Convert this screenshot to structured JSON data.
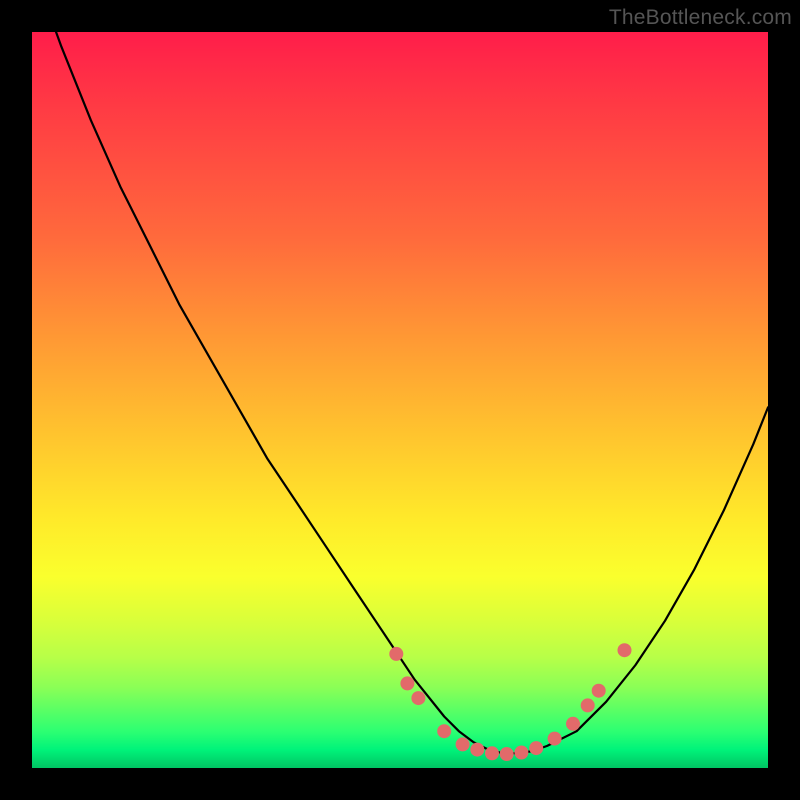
{
  "watermark": "TheBottleneck.com",
  "colors": {
    "frame_background": "#000000",
    "gradient_top": "#ff1d4a",
    "gradient_mid": "#ffe92a",
    "gradient_bottom": "#00c463",
    "curve": "#000000",
    "dots": "#e26a6a"
  },
  "chart_data": {
    "type": "line",
    "title": "",
    "xlabel": "",
    "ylabel": "",
    "xlim": [
      0,
      100
    ],
    "ylim": [
      0,
      100
    ],
    "grid": false,
    "series": [
      {
        "name": "curve",
        "x": [
          0,
          4,
          8,
          12,
          16,
          20,
          24,
          28,
          32,
          36,
          40,
          44,
          48,
          52,
          56,
          58,
          60,
          62,
          64,
          66,
          68,
          70,
          74,
          78,
          82,
          86,
          90,
          94,
          98,
          100
        ],
        "y": [
          109,
          98,
          88,
          79,
          71,
          63,
          56,
          49,
          42,
          36,
          30,
          24,
          18,
          12,
          7,
          5,
          3.5,
          2.5,
          2,
          2,
          2.3,
          3,
          5,
          9,
          14,
          20,
          27,
          35,
          44,
          49
        ]
      }
    ],
    "markers": [
      {
        "x": 49.5,
        "y": 15.5
      },
      {
        "x": 51.0,
        "y": 11.5
      },
      {
        "x": 52.5,
        "y": 9.5
      },
      {
        "x": 56.0,
        "y": 5.0
      },
      {
        "x": 58.5,
        "y": 3.2
      },
      {
        "x": 60.5,
        "y": 2.5
      },
      {
        "x": 62.5,
        "y": 2.0
      },
      {
        "x": 64.5,
        "y": 1.9
      },
      {
        "x": 66.5,
        "y": 2.1
      },
      {
        "x": 68.5,
        "y": 2.7
      },
      {
        "x": 71.0,
        "y": 4.0
      },
      {
        "x": 73.5,
        "y": 6.0
      },
      {
        "x": 75.5,
        "y": 8.5
      },
      {
        "x": 77.0,
        "y": 10.5
      },
      {
        "x": 80.5,
        "y": 16.0
      }
    ]
  }
}
